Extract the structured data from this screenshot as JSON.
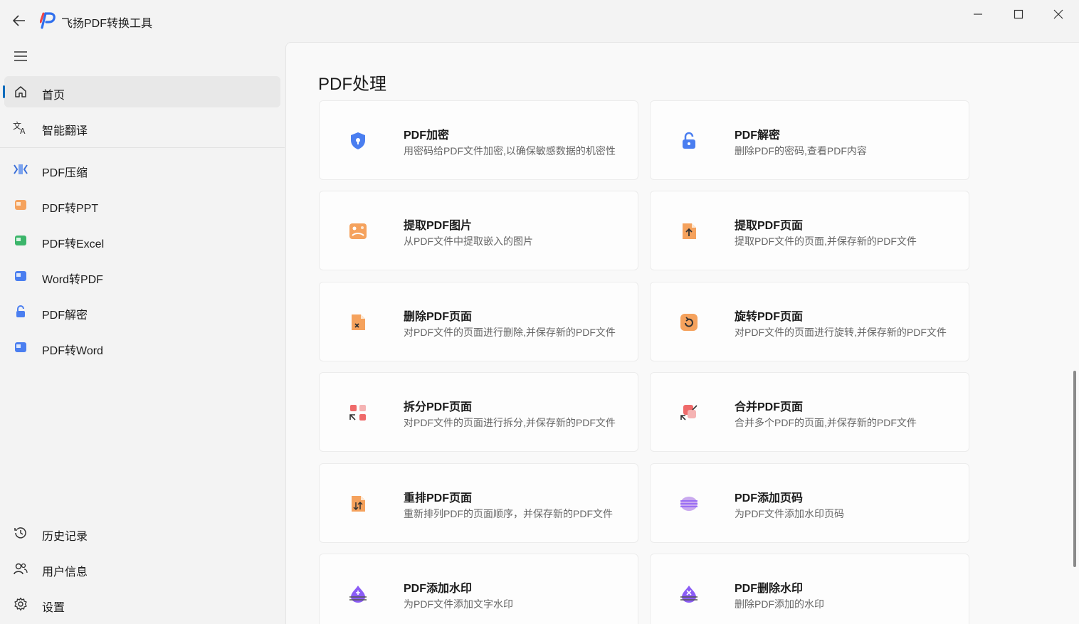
{
  "app": {
    "title": "飞扬PDF转换工具",
    "accent_color": "#0f6cbd"
  },
  "titlebar": {
    "back_icon": "arrow-left-icon",
    "min_icon": "minimize-icon",
    "max_icon": "maximize-icon",
    "close_icon": "close-icon"
  },
  "sidebar": {
    "top_items": [
      {
        "label": "首页",
        "icon": "home-icon",
        "active": true
      },
      {
        "label": "智能翻译",
        "icon": "translate-icon"
      }
    ],
    "tool_items": [
      {
        "label": "PDF压缩",
        "icon": "compress-icon"
      },
      {
        "label": "PDF转PPT",
        "icon": "ppt-icon"
      },
      {
        "label": "PDF转Excel",
        "icon": "excel-icon"
      },
      {
        "label": "Word转PDF",
        "icon": "word-icon"
      },
      {
        "label": "PDF解密",
        "icon": "unlock-icon"
      },
      {
        "label": "PDF转Word",
        "icon": "word-icon"
      }
    ],
    "bottom_items": [
      {
        "label": "历史记录",
        "icon": "history-icon"
      },
      {
        "label": "用户信息",
        "icon": "users-icon"
      },
      {
        "label": "设置",
        "icon": "gear-icon"
      }
    ]
  },
  "main": {
    "section_title": "PDF处理",
    "cards": [
      {
        "title": "PDF加密",
        "desc": "用密码给PDF文件加密,以确保敏感数据的机密性",
        "icon": "shield-lock-icon"
      },
      {
        "title": "PDF解密",
        "desc": "删除PDF的密码,查看PDF内容",
        "icon": "unlock-icon"
      },
      {
        "title": "提取PDF图片",
        "desc": "从PDF文件中提取嵌入的图片",
        "icon": "image-extract-icon"
      },
      {
        "title": "提取PDF页面",
        "desc": "提取PDF文件的页面,并保存新的PDF文件",
        "icon": "page-extract-icon"
      },
      {
        "title": "删除PDF页面",
        "desc": "对PDF文件的页面进行删除,并保存新的PDF文件",
        "icon": "page-delete-icon"
      },
      {
        "title": "旋转PDF页面",
        "desc": "对PDF文件的页面进行旋转,并保存新的PDF文件",
        "icon": "rotate-icon"
      },
      {
        "title": "拆分PDF页面",
        "desc": "对PDF文件的页面进行拆分,并保存新的PDF文件",
        "icon": "split-icon"
      },
      {
        "title": "合并PDF页面",
        "desc": "合并多个PDF的页面,并保存新的PDF文件",
        "icon": "merge-icon"
      },
      {
        "title": "重排PDF页面",
        "desc": "重新排列PDF的页面顺序，并保存新的PDF文件",
        "icon": "reorder-icon"
      },
      {
        "title": "PDF添加页码",
        "desc": "为PDF文件添加水印页码",
        "icon": "page-number-icon"
      },
      {
        "title": "PDF添加水印",
        "desc": "为PDF文件添加文字水印",
        "icon": "watermark-add-icon"
      },
      {
        "title": "PDF删除水印",
        "desc": "删除PDF添加的水印",
        "icon": "watermark-remove-icon"
      }
    ]
  }
}
